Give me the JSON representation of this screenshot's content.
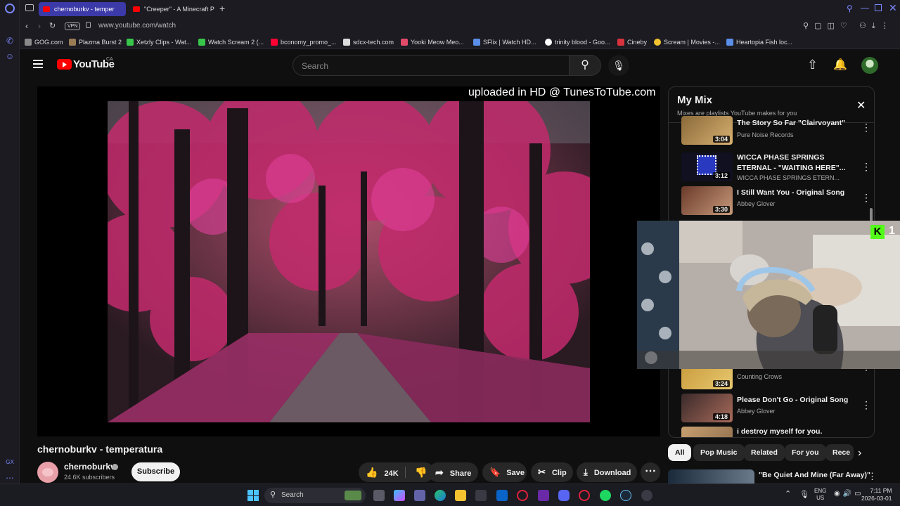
{
  "browser": {
    "tabs": [
      {
        "label": "chernoburkv - temper"
      },
      {
        "label": "\"Creeper\" - A Minecraft P"
      }
    ],
    "vpn_label": "VPN",
    "url": "www.youtube.com/watch",
    "bookmarks": [
      {
        "label": "GOG.com",
        "color": "#8a8a8a"
      },
      {
        "label": "Plazma Burst 2",
        "color": "#9a7c55"
      },
      {
        "label": "Xetzly Clips - Wat...",
        "color": "#38c64a"
      },
      {
        "label": "Watch Scream 2 (...",
        "color": "#38c64a"
      },
      {
        "label": "bconomy_promo_...",
        "color": "#ff0033"
      },
      {
        "label": "sdcx-tech.com",
        "color": "#dddddd"
      },
      {
        "label": "Yooki Meow Meo...",
        "color": "#e24a6a"
      },
      {
        "label": "SFlix | Watch HD...",
        "color": "#5a8ee8"
      },
      {
        "label": "trinity blood - Goo...",
        "color": "#ffffff"
      },
      {
        "label": "Cineby",
        "color": "#d8333c"
      },
      {
        "label": "Scream | Movies -...",
        "color": "#f4c430"
      },
      {
        "label": "Heartopia Fish loc...",
        "color": "#5a8ee8"
      }
    ]
  },
  "youtube": {
    "logo_text": "YouTube",
    "country": "CA",
    "search_placeholder": "Search"
  },
  "video": {
    "watermark": "uploaded in HD @ TunesToTube.com",
    "title": "chernoburkv - temperatura",
    "channel": "chernoburkv",
    "subscribers": "24.6K subscribers",
    "subscribe_label": "Subscribe",
    "likes": "24K",
    "share_label": "Share",
    "save_label": "Save",
    "clip_label": "Clip",
    "download_label": "Download"
  },
  "playlist": {
    "title": "My Mix",
    "subtitle": "Mixes are playlists YouTube makes for you",
    "items": [
      {
        "title": "The Story So Far \"Clairvoyant\"",
        "channel": "Pure Noise Records",
        "duration": "3:04"
      },
      {
        "title": "WICCA PHASE SPRINGS ETERNAL - \"WAITING HERE\"...",
        "channel": "WICCA PHASE SPRINGS ETERN...",
        "duration": "3:12"
      },
      {
        "title": "I Still Want You - Original Song",
        "channel": "Abbey Glover",
        "duration": "3:30"
      },
      {
        "title": "",
        "channel": "Counting Crows",
        "duration": "3:24"
      },
      {
        "title": "Please Don't Go - Original Song",
        "channel": "Abbey Glover",
        "duration": "4:18"
      },
      {
        "title": "i destroy myself for you.",
        "channel": "",
        "duration": ""
      }
    ]
  },
  "chips": [
    "All",
    "Pop Music",
    "Related",
    "For you",
    "Rece"
  ],
  "related": {
    "title": "\"Be Quiet And Mine (Far Away)\""
  },
  "webcam": {
    "badge": "1"
  },
  "taskbar": {
    "search_label": "Search",
    "lang_top": "ENG",
    "lang_bottom": "US",
    "time": "7:11 PM",
    "date": "2026-03-01"
  }
}
